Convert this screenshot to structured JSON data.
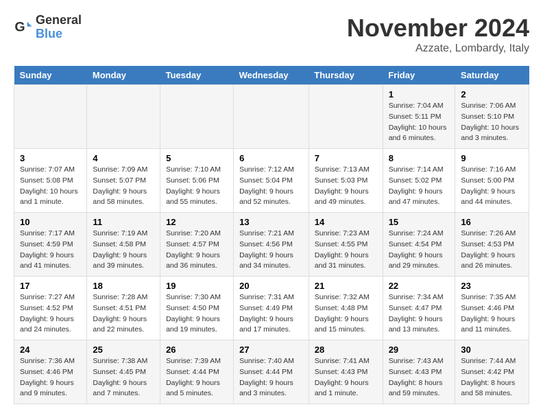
{
  "header": {
    "logo_line1": "General",
    "logo_line2": "Blue",
    "month": "November 2024",
    "location": "Azzate, Lombardy, Italy"
  },
  "weekdays": [
    "Sunday",
    "Monday",
    "Tuesday",
    "Wednesday",
    "Thursday",
    "Friday",
    "Saturday"
  ],
  "weeks": [
    [
      {
        "day": "",
        "info": ""
      },
      {
        "day": "",
        "info": ""
      },
      {
        "day": "",
        "info": ""
      },
      {
        "day": "",
        "info": ""
      },
      {
        "day": "",
        "info": ""
      },
      {
        "day": "1",
        "info": "Sunrise: 7:04 AM\nSunset: 5:11 PM\nDaylight: 10 hours and 6 minutes."
      },
      {
        "day": "2",
        "info": "Sunrise: 7:06 AM\nSunset: 5:10 PM\nDaylight: 10 hours and 3 minutes."
      }
    ],
    [
      {
        "day": "3",
        "info": "Sunrise: 7:07 AM\nSunset: 5:08 PM\nDaylight: 10 hours and 1 minute."
      },
      {
        "day": "4",
        "info": "Sunrise: 7:09 AM\nSunset: 5:07 PM\nDaylight: 9 hours and 58 minutes."
      },
      {
        "day": "5",
        "info": "Sunrise: 7:10 AM\nSunset: 5:06 PM\nDaylight: 9 hours and 55 minutes."
      },
      {
        "day": "6",
        "info": "Sunrise: 7:12 AM\nSunset: 5:04 PM\nDaylight: 9 hours and 52 minutes."
      },
      {
        "day": "7",
        "info": "Sunrise: 7:13 AM\nSunset: 5:03 PM\nDaylight: 9 hours and 49 minutes."
      },
      {
        "day": "8",
        "info": "Sunrise: 7:14 AM\nSunset: 5:02 PM\nDaylight: 9 hours and 47 minutes."
      },
      {
        "day": "9",
        "info": "Sunrise: 7:16 AM\nSunset: 5:00 PM\nDaylight: 9 hours and 44 minutes."
      }
    ],
    [
      {
        "day": "10",
        "info": "Sunrise: 7:17 AM\nSunset: 4:59 PM\nDaylight: 9 hours and 41 minutes."
      },
      {
        "day": "11",
        "info": "Sunrise: 7:19 AM\nSunset: 4:58 PM\nDaylight: 9 hours and 39 minutes."
      },
      {
        "day": "12",
        "info": "Sunrise: 7:20 AM\nSunset: 4:57 PM\nDaylight: 9 hours and 36 minutes."
      },
      {
        "day": "13",
        "info": "Sunrise: 7:21 AM\nSunset: 4:56 PM\nDaylight: 9 hours and 34 minutes."
      },
      {
        "day": "14",
        "info": "Sunrise: 7:23 AM\nSunset: 4:55 PM\nDaylight: 9 hours and 31 minutes."
      },
      {
        "day": "15",
        "info": "Sunrise: 7:24 AM\nSunset: 4:54 PM\nDaylight: 9 hours and 29 minutes."
      },
      {
        "day": "16",
        "info": "Sunrise: 7:26 AM\nSunset: 4:53 PM\nDaylight: 9 hours and 26 minutes."
      }
    ],
    [
      {
        "day": "17",
        "info": "Sunrise: 7:27 AM\nSunset: 4:52 PM\nDaylight: 9 hours and 24 minutes."
      },
      {
        "day": "18",
        "info": "Sunrise: 7:28 AM\nSunset: 4:51 PM\nDaylight: 9 hours and 22 minutes."
      },
      {
        "day": "19",
        "info": "Sunrise: 7:30 AM\nSunset: 4:50 PM\nDaylight: 9 hours and 19 minutes."
      },
      {
        "day": "20",
        "info": "Sunrise: 7:31 AM\nSunset: 4:49 PM\nDaylight: 9 hours and 17 minutes."
      },
      {
        "day": "21",
        "info": "Sunrise: 7:32 AM\nSunset: 4:48 PM\nDaylight: 9 hours and 15 minutes."
      },
      {
        "day": "22",
        "info": "Sunrise: 7:34 AM\nSunset: 4:47 PM\nDaylight: 9 hours and 13 minutes."
      },
      {
        "day": "23",
        "info": "Sunrise: 7:35 AM\nSunset: 4:46 PM\nDaylight: 9 hours and 11 minutes."
      }
    ],
    [
      {
        "day": "24",
        "info": "Sunrise: 7:36 AM\nSunset: 4:46 PM\nDaylight: 9 hours and 9 minutes."
      },
      {
        "day": "25",
        "info": "Sunrise: 7:38 AM\nSunset: 4:45 PM\nDaylight: 9 hours and 7 minutes."
      },
      {
        "day": "26",
        "info": "Sunrise: 7:39 AM\nSunset: 4:44 PM\nDaylight: 9 hours and 5 minutes."
      },
      {
        "day": "27",
        "info": "Sunrise: 7:40 AM\nSunset: 4:44 PM\nDaylight: 9 hours and 3 minutes."
      },
      {
        "day": "28",
        "info": "Sunrise: 7:41 AM\nSunset: 4:43 PM\nDaylight: 9 hours and 1 minute."
      },
      {
        "day": "29",
        "info": "Sunrise: 7:43 AM\nSunset: 4:43 PM\nDaylight: 8 hours and 59 minutes."
      },
      {
        "day": "30",
        "info": "Sunrise: 7:44 AM\nSunset: 4:42 PM\nDaylight: 8 hours and 58 minutes."
      }
    ]
  ]
}
